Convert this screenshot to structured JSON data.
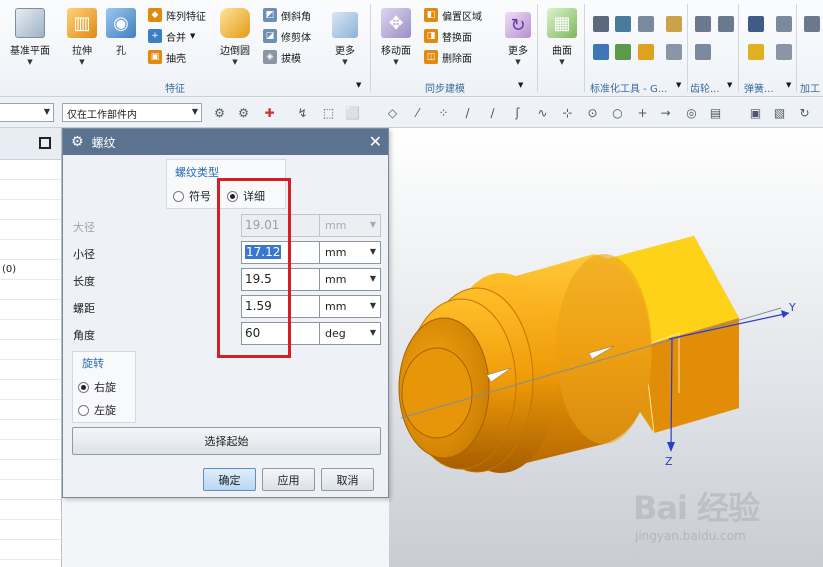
{
  "ribbon": {
    "feature_buttons": [
      {
        "label": "基准平面",
        "icon": "datum-plane-icon"
      },
      {
        "label": "拉伸",
        "icon": "extrude-icon"
      },
      {
        "label": "孔",
        "icon": "hole-icon"
      }
    ],
    "feature_small": [
      {
        "label": "阵列特征",
        "icon": "pattern-feature-icon"
      },
      {
        "label": "合并",
        "icon": "unite-icon"
      },
      {
        "label": "抽壳",
        "icon": "shell-icon"
      }
    ],
    "edge_button": {
      "label": "边倒圆",
      "icon": "edge-blend-icon"
    },
    "edge_small": [
      {
        "label": "倒斜角",
        "icon": "chamfer-icon"
      },
      {
        "label": "修剪体",
        "icon": "trim-body-icon"
      },
      {
        "label": "拔模",
        "icon": "draft-icon"
      }
    ],
    "more_label": "更多",
    "group_feature": "特征",
    "move_face_label": "移动面",
    "sync_small": [
      {
        "label": "偏置区域",
        "icon": "offset-region-icon"
      },
      {
        "label": "替换面",
        "icon": "replace-face-icon"
      },
      {
        "label": "删除面",
        "icon": "delete-face-icon"
      }
    ],
    "group_sync": "同步建模",
    "surface_label": "曲面",
    "group_stdtools": "标准化工具 - G...",
    "group_gear": "齿轮...",
    "group_spring": "弹簧...",
    "group_machining": "加工"
  },
  "toolbar": {
    "filter_value": "",
    "scope_value": "仅在工作部件内"
  },
  "navigator": {
    "row_text": "(0)"
  },
  "dialog": {
    "title": "螺纹",
    "thread_type_legend": "螺纹类型",
    "type_symbolic": "符号",
    "type_detailed": "详细",
    "selected_type": "详细",
    "params": [
      {
        "label": "大径",
        "value": "19.01",
        "unit": "mm",
        "disabled": true
      },
      {
        "label": "小径",
        "value": "17.12",
        "unit": "mm",
        "disabled": false,
        "selected": true
      },
      {
        "label": "长度",
        "value": "19.5",
        "unit": "mm",
        "disabled": false
      },
      {
        "label": "螺距",
        "value": "1.59",
        "unit": "mm",
        "disabled": false
      },
      {
        "label": "角度",
        "value": "60",
        "unit": "deg",
        "disabled": false
      }
    ],
    "rotation_legend": "旋转",
    "rot_right": "右旋",
    "rot_left": "左旋",
    "selected_rotation": "右旋",
    "select_start_label": "选择起始",
    "ok_label": "确定",
    "apply_label": "应用",
    "cancel_label": "取消"
  },
  "viewport": {
    "axis_y": "Y",
    "axis_z": "Z",
    "watermark_logo": "Bai 经验",
    "watermark_url": "jingyan.baidu.com",
    "part_color": "#f0a10c"
  }
}
